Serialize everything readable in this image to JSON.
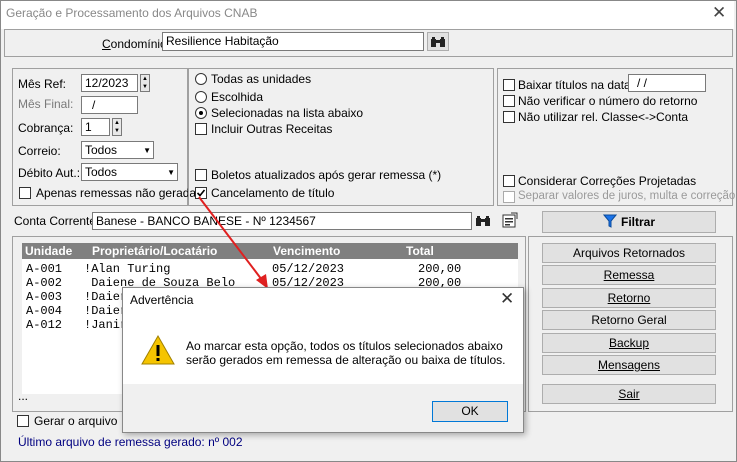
{
  "window": {
    "title": "Geração e Processamento dos Arquivos CNAB",
    "close": "✕"
  },
  "condominio": {
    "label": "Condomínio:",
    "value": "Resilience Habitação"
  },
  "params": {
    "mes_ref_label": "Mês Ref:",
    "mes_ref_value": "12/2023",
    "mes_final_label": "Mês Final:",
    "mes_final_value": "/",
    "cobranca_label": "Cobrança:",
    "cobranca_value": "1",
    "correio_label": "Correio:",
    "correio_value": "Todos",
    "debito_label": "Débito Aut.:",
    "debito_value": "Todos",
    "apenas_label": "Apenas remessas não geradas"
  },
  "units": {
    "todas": "Todas as unidades",
    "escolhida": "Escolhida",
    "selecionadas": "Selecionadas na lista abaixo",
    "incluir": "Incluir Outras Receitas",
    "boletos": "Boletos atualizados após gerar remessa (*)",
    "cancelamento": "Cancelamento de título"
  },
  "options": {
    "baixar_label": "Baixar títulos na data:",
    "baixar_value": " / /",
    "nao_verificar": "Não verificar o número do retorno",
    "nao_utilizar": "Não utilizar rel. Classe<->Conta",
    "considerar": "Considerar Correções Projetadas",
    "separar": "Separar valores de juros, multa e correção"
  },
  "conta": {
    "label": "Conta Corrente:",
    "value": "Banese - BANCO BANESE - Nº 1234567"
  },
  "filtrar_label": "Filtrar",
  "table": {
    "headers": [
      "Unidade",
      "Proprietário/Locatário",
      "Vencimento",
      "Total"
    ],
    "rows": [
      {
        "unidade": "A-001",
        "prop": "!Alan Turing",
        "venc": "05/12/2023",
        "total": "200,00"
      },
      {
        "unidade": "A-002",
        "prop": " Daiene de Souza Belo",
        "venc": "05/12/2023",
        "total": "200,00"
      },
      {
        "unidade": "A-003",
        "prop": "!Daier",
        "venc": "",
        "total": ""
      },
      {
        "unidade": "A-004",
        "prop": "!Daier",
        "venc": "",
        "total": ""
      },
      {
        "unidade": "A-012",
        "prop": "!Janir",
        "venc": "",
        "total": ""
      }
    ],
    "ellipsis": "..."
  },
  "actions": {
    "retornados": "Arquivos Retornados",
    "remessa": "Remessa",
    "retorno": "Retorno",
    "retorno_geral": "Retorno Geral",
    "backup": "Backup",
    "mensagens": "Mensagens",
    "sair": "Sair"
  },
  "gerar_label": "Gerar o arquivo",
  "ultimo": "Último arquivo de remessa gerado: nº 002",
  "dialog": {
    "title": "Advertência",
    "line1": "Ao marcar esta opção, todos os títulos selecionados abaixo",
    "line2": "serão gerados em remessa de alteração ou baixa de títulos.",
    "ok": "OK",
    "close": "✕"
  },
  "colors": {
    "table_header": "#808080",
    "link_blue": "#000080",
    "annotation_arrow": "#e02020",
    "warning_yellow": "#f5c400"
  }
}
